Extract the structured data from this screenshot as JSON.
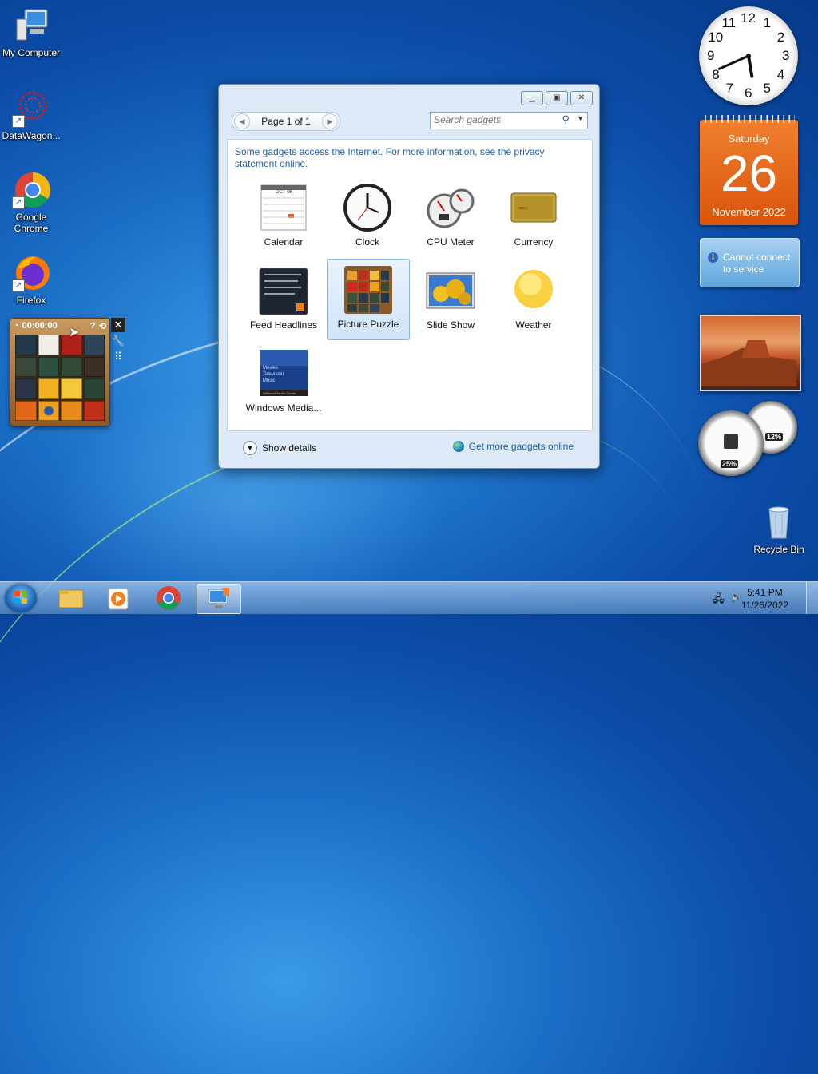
{
  "desktop": {
    "icons": [
      {
        "label": "My Computer"
      },
      {
        "label": "DataWagon..."
      },
      {
        "label": "Google Chrome"
      },
      {
        "label": "Firefox"
      },
      {
        "label": "Recycle Bin"
      }
    ]
  },
  "puzzle_gadget": {
    "timer": "00:00:00"
  },
  "gadget_window": {
    "pager": "Page 1 of 1",
    "search_placeholder": "Search gadgets",
    "info_text": "Some gadgets access the Internet.  For more information, see the privacy statement online.",
    "gadgets": [
      {
        "label": "Calendar"
      },
      {
        "label": "Clock"
      },
      {
        "label": "CPU Meter"
      },
      {
        "label": "Currency"
      },
      {
        "label": "Feed Headlines"
      },
      {
        "label": "Picture Puzzle",
        "selected": true
      },
      {
        "label": "Slide Show"
      },
      {
        "label": "Weather"
      },
      {
        "label": "Windows Media..."
      }
    ],
    "show_details": "Show details",
    "get_more": "Get more gadgets online",
    "calendar_thumb_month": "OCT 06",
    "media_thumb_items": [
      "Movies",
      "Television",
      "Music"
    ],
    "media_thumb_footer": "Windows Media Center"
  },
  "clock_gadget": {
    "numerals": [
      "12",
      "1",
      "2",
      "3",
      "4",
      "5",
      "6",
      "7",
      "8",
      "9",
      "10",
      "11"
    ],
    "hour": 5,
    "minute": 41
  },
  "calendar_gadget": {
    "weekday": "Saturday",
    "day": "26",
    "month_year": "November 2022"
  },
  "weather_gadget": {
    "message": "Cannot connect to service"
  },
  "cpu_gadget": {
    "cpu": "25%",
    "memory": "12%"
  },
  "taskbar": {
    "time": "5:41 PM",
    "date": "11/26/2022"
  },
  "colors": {
    "accent": "#1e5fa8",
    "calendar": "#e8661c"
  }
}
